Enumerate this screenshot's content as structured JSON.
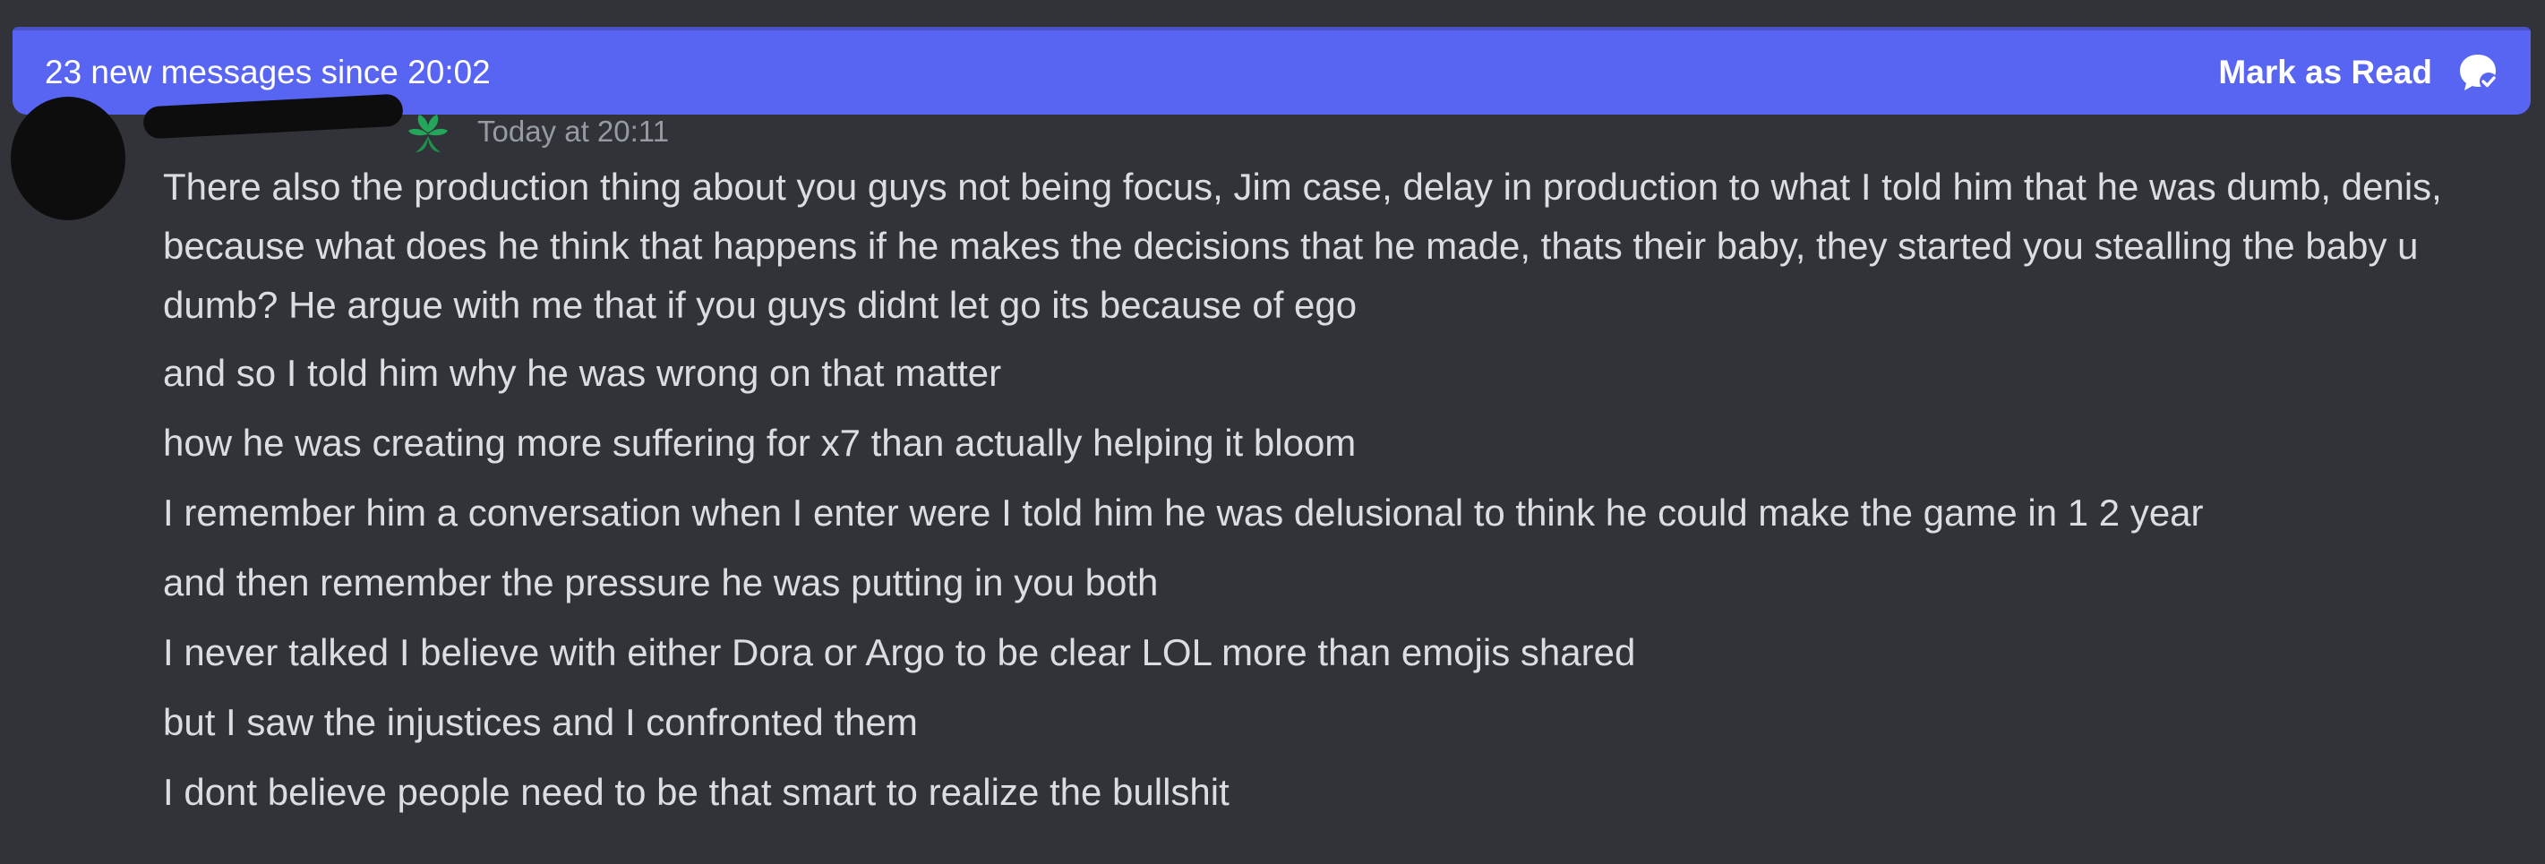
{
  "new_messages_bar": {
    "text": "23 new messages since 20:02",
    "mark_as_read_label": "Mark as Read",
    "icon": "mark-read-icon",
    "color": "#5865f2"
  },
  "message_group": {
    "timestamp": "Today at 20:11",
    "role_icon": "leaf-role-icon",
    "messages": [
      "There also the production thing about you guys not being focus, Jim case, delay in production to what I told him that he was dumb, denis, because what does he think that happens if he makes the decisions that he made, thats their baby, they started you stealling the baby u dumb? He argue with me that if you guys didnt let go its because of ego",
      "and so I told him why he was wrong on that matter",
      "how he was creating more suffering for x7 than actually helping it bloom",
      "I remember him a conversation when I enter were I told him he was delusional to think he could make the game in 1 2 year",
      "and then remember the pressure he was putting in you both",
      "I never talked I believe with either Dora or Argo to be clear LOL more than emojis shared",
      "but I saw the injustices and I confronted them",
      "I dont believe people need to be that smart to realize the bullshit"
    ]
  },
  "colors": {
    "background": "#313338",
    "text": "#dbdee1",
    "muted": "#949ba4",
    "accent": "#5865f2",
    "role_green": "#23a55a"
  }
}
